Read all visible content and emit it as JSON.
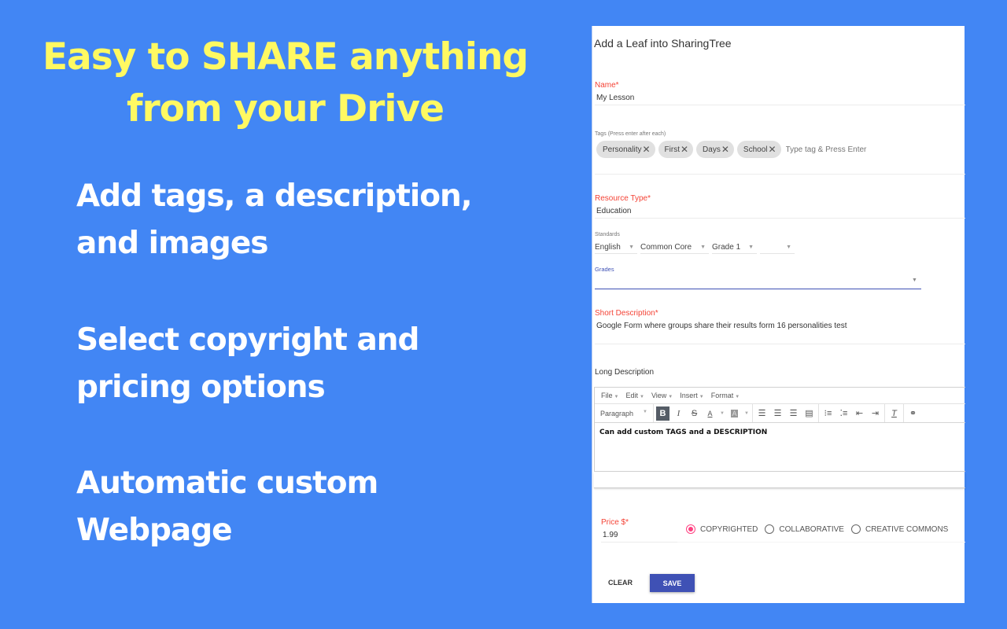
{
  "promo": {
    "headline": [
      "Easy to SHARE anything",
      "from your Drive"
    ],
    "features": [
      [
        "Add tags, a description,",
        "and images"
      ],
      [
        "Select copyright and",
        "pricing options"
      ],
      [
        "Automatic custom",
        "Webpage"
      ]
    ],
    "colors": {
      "background": "#4286f4",
      "headline": "#fff962",
      "feature": "#ffffff"
    }
  },
  "form": {
    "title": "Add a Leaf into SharingTree",
    "name": {
      "label": "Name*",
      "value": "My Lesson"
    },
    "tags": {
      "label": "Tags (Press enter after each)",
      "chips": [
        "Personality",
        "First",
        "Days",
        "School"
      ],
      "placeholder": "Type tag & Press Enter"
    },
    "resource_type": {
      "label": "Resource Type*",
      "value": "Education"
    },
    "standards": {
      "label": "Standards",
      "selects": [
        "English",
        "Common Core",
        "Grade 1",
        ""
      ]
    },
    "grades": {
      "label": "Grades",
      "value": ""
    },
    "short_description": {
      "label": "Short Description*",
      "value": "Google Form where groups share their results form 16 personalities test"
    },
    "long_description": {
      "label": "Long Description",
      "menu": [
        "File",
        "Edit",
        "View",
        "Insert",
        "Format"
      ],
      "paragraph_select": "Paragraph",
      "toolbar_icons": [
        "bold-icon",
        "italic-icon",
        "strikethrough-icon",
        "text-color-icon",
        "background-color-icon",
        "align-left-icon",
        "align-center-icon",
        "align-right-icon",
        "align-justify-icon",
        "numbered-list-icon",
        "bullet-list-icon",
        "outdent-icon",
        "indent-icon",
        "clear-formatting-icon",
        "link-icon"
      ],
      "content": "Can add custom TAGS and a DESCRIPTION"
    },
    "price": {
      "label": "Price $*",
      "value": "1.99"
    },
    "license": {
      "options": [
        "COPYRIGHTED",
        "COLLABORATIVE",
        "CREATIVE COMMONS"
      ],
      "selected": "COPYRIGHTED"
    },
    "buttons": {
      "clear": "CLEAR",
      "save": "SAVE"
    },
    "colors": {
      "required_label": "#f44336",
      "primary": "#3f51b5",
      "radio_accent": "#ff4081"
    }
  }
}
